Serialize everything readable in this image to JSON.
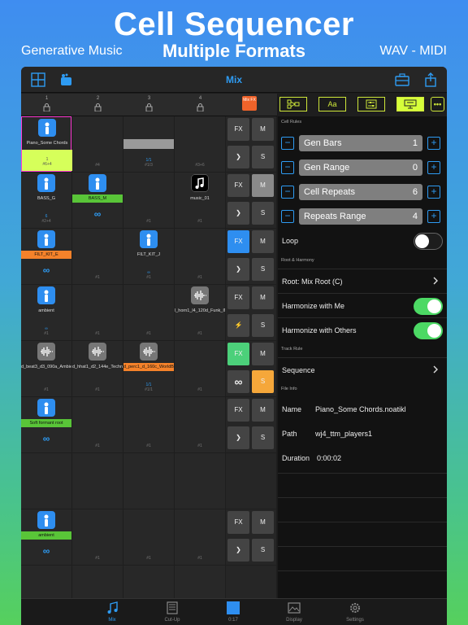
{
  "promo": {
    "title": "Cell Sequencer",
    "subtitle": "Multiple Formats",
    "left_tag": "Generative Music",
    "right_tag": "WAV - MIDI"
  },
  "nav": {
    "title": "Mix"
  },
  "tracks": [
    {
      "num": "1"
    },
    {
      "num": "2"
    },
    {
      "num": "3"
    },
    {
      "num": "4"
    }
  ],
  "mix_fx_label": "Mix FX",
  "cells": {
    "r0c0": {
      "label": "Piano_Some Chords",
      "meta1": "1",
      "meta2": "#6+4"
    },
    "r0c1": {
      "meta1": "#4"
    },
    "r0c2": {
      "meta1": "1/1",
      "meta2": "#1/3"
    },
    "r0c3": {
      "meta1": "#3+6"
    },
    "r1c0": {
      "label": "BASS_G",
      "meta1": "6",
      "meta2": "#2+4"
    },
    "r1c1": {
      "label": "BASS_M",
      "inf": "∞"
    },
    "r1c2": {
      "meta1": "#1"
    },
    "r1c3": {
      "label": "music_01",
      "meta1": "#1"
    },
    "r2c0": {
      "label": "FILT_KIT_E",
      "inf": "∞"
    },
    "r2c1": {
      "meta1": "#1"
    },
    "r2c2": {
      "label": "FILT_KIT_J",
      "meta1": "∞",
      "meta2": "#1"
    },
    "r2c3": {
      "meta1": "#1"
    },
    "r3c0": {
      "label": "ambient",
      "meta1": "∞",
      "meta2": "#1"
    },
    "r3c1": {
      "meta1": "#1"
    },
    "r3c2": {
      "meta1": "#1"
    },
    "r3c3": {
      "label": "l_horn1_l4_120d_Funk_IM",
      "meta1": "#1"
    },
    "r4c0": {
      "label": "d_beat3_d3_090a_Ambient_IM",
      "meta1": "#1"
    },
    "r4c1": {
      "label": "d_hhat1_d2_144e_Techno_IM",
      "meta1": "#1"
    },
    "r4c2": {
      "label": "d_perc1_d_160c_WorldBeat_IM",
      "meta1": "1/1",
      "meta2": "#1/1"
    },
    "r4c3": {
      "meta1": "#1"
    },
    "r5c0": {
      "label": "Soft formant root",
      "inf": "∞"
    },
    "r5c1": {
      "meta1": "#1"
    },
    "r5c2": {
      "meta1": "#1"
    },
    "r5c3": {
      "meta1": "#1"
    },
    "r7c0": {
      "label": "ambient",
      "inf": "∞"
    },
    "r7c1": {
      "meta1": "#1"
    },
    "r7c2": {
      "meta1": "#1"
    },
    "r7c3": {
      "meta1": "#1"
    }
  },
  "ctrl": {
    "fx": "FX",
    "m": "M",
    "s": "S",
    "play": "❯",
    "bolt": "⚡",
    "inf": "∞"
  },
  "panel": {
    "cell_rules_header": "Cell Rules",
    "steppers": [
      {
        "label": "Gen Bars",
        "value": "1"
      },
      {
        "label": "Gen Range",
        "value": "0"
      },
      {
        "label": "Cell Repeats",
        "value": "6"
      },
      {
        "label": "Repeats Range",
        "value": "4"
      }
    ],
    "loop_label": "Loop",
    "root_header": "Root & Harmony",
    "root_value": "Root: Mix Root (C)",
    "harmonize_me": "Harmonize with Me",
    "harmonize_others": "Harmonize with Others",
    "track_rule_header": "Track Rule",
    "track_rule_value": "Sequence",
    "file_info_header": "File Info",
    "file_name_key": "Name",
    "file_name_val": "Piano_Some Chords.noatikl",
    "path_key": "Path",
    "path_val": "wj4_ttm_players1",
    "duration_key": "Duration",
    "duration_val": "0:00:02",
    "toolbar_font": "Aa"
  },
  "tabs": [
    {
      "label": "Mix"
    },
    {
      "label": "Cut-Up"
    },
    {
      "label": "0:17"
    },
    {
      "label": "Display"
    },
    {
      "label": "Settings"
    }
  ],
  "colors": {
    "accent_blue": "#2e9bf2",
    "highlight_yellow": "#d6ff5a",
    "green": "#59c538",
    "orange": "#f5822a"
  }
}
